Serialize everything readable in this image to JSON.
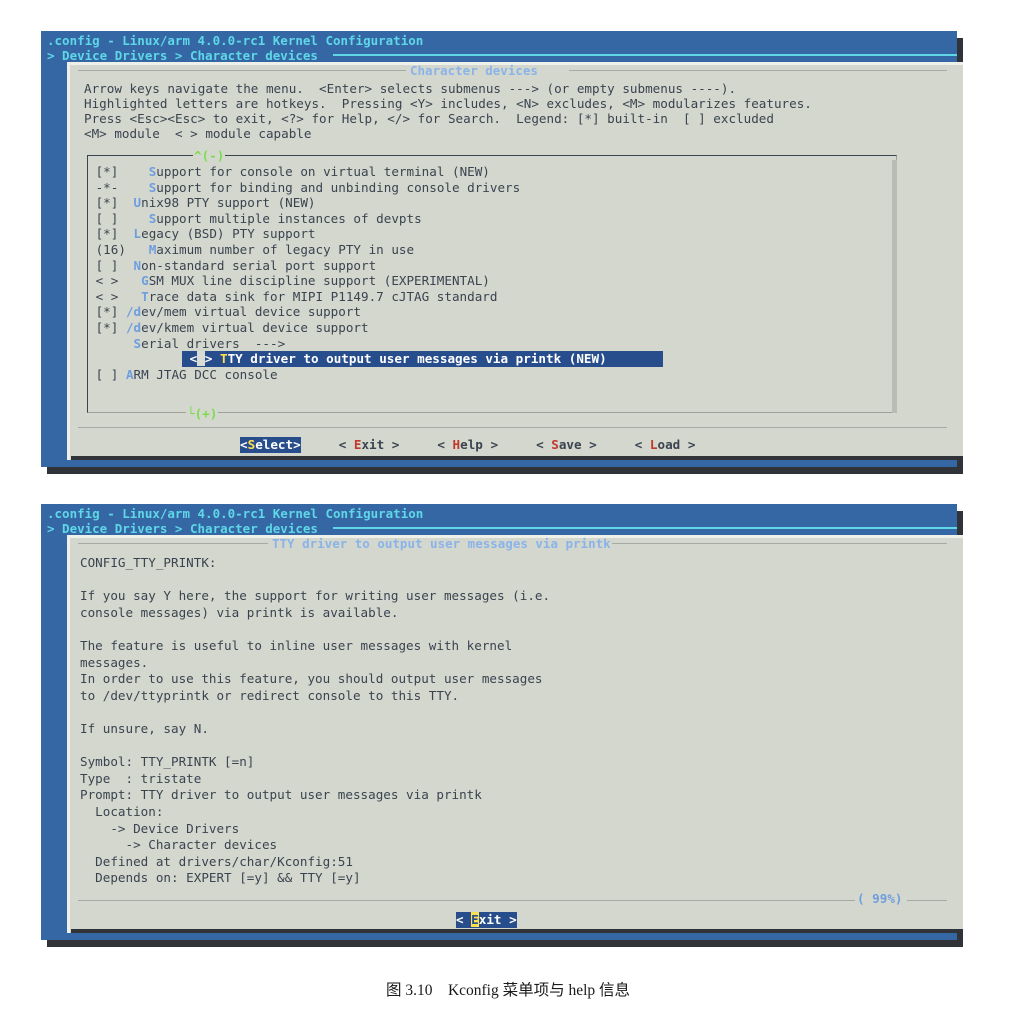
{
  "window_top": {
    "title": ".config - Linux/arm 4.0.0-rc1 Kernel Configuration",
    "path": "> Device Drivers > Character devices",
    "dialog_title": "Character devices",
    "help_lines": [
      "Arrow keys navigate the menu.  <Enter> selects submenus ---> (or empty submenus ----).",
      "Highlighted letters are hotkeys.  Pressing <Y> includes, <N> excludes, <M> modularizes features.",
      "Press <Esc><Esc> to exit, <?> for Help, </> for Search.  Legend: [*] built-in  [ ] excluded",
      "<M> module  < > module capable"
    ],
    "scroll_up_mark": "^(-)",
    "scroll_down_mark": "└(+)",
    "menu_items": [
      {
        "state": "[*]",
        "indent": "    ",
        "hotkey": "S",
        "rest": "upport for console on virtual terminal (NEW)",
        "selected": false
      },
      {
        "state": "-*-",
        "indent": "    ",
        "hotkey": "S",
        "rest": "upport for binding and unbinding console drivers",
        "selected": false
      },
      {
        "state": "[*]",
        "indent": "  ",
        "hotkey": "U",
        "rest": "nix98 PTY support (NEW)",
        "selected": false
      },
      {
        "state": "[ ]",
        "indent": "    ",
        "hotkey": "S",
        "rest": "upport multiple instances of devpts",
        "selected": false
      },
      {
        "state": "[*]",
        "indent": "  ",
        "hotkey": "L",
        "rest": "egacy (BSD) PTY support",
        "selected": false
      },
      {
        "state": "(16)",
        "indent": "   ",
        "hotkey": "M",
        "rest": "aximum number of legacy PTY in use",
        "selected": false
      },
      {
        "state": "[ ]",
        "indent": "  ",
        "hotkey": "N",
        "rest": "on-standard serial port support",
        "selected": false
      },
      {
        "state": "< >",
        "indent": "   ",
        "hotkey": "G",
        "rest": "SM MUX line discipline support (EXPERIMENTAL)",
        "selected": false
      },
      {
        "state": "< >",
        "indent": "   ",
        "hotkey": "T",
        "rest": "race data sink for MIPI P1149.7 cJTAG standard",
        "selected": false
      },
      {
        "state": "[*]",
        "indent": " ",
        "hotkey": "/d",
        "rest": "ev/mem virtual device support",
        "selected": false
      },
      {
        "state": "[*]",
        "indent": " ",
        "hotkey": "/d",
        "rest": "ev/kmem virtual device support",
        "selected": false
      },
      {
        "state": "   ",
        "indent": "  ",
        "hotkey": "S",
        "rest": "erial drivers  --->",
        "selected": false
      },
      {
        "state": "< >",
        "indent": " ",
        "hotkey": "T",
        "rest": "TY driver to output user messages via printk (NEW)",
        "selected": true
      },
      {
        "state": "[ ]",
        "indent": " ",
        "hotkey": "A",
        "rest": "RM JTAG DCC console",
        "selected": false
      }
    ],
    "buttons": [
      {
        "label": "<Select>",
        "hotkey": "S",
        "pre": "<",
        "post": "elect>",
        "active": true
      },
      {
        "label": "< Exit >",
        "hotkey": "E",
        "pre": "< ",
        "post": "xit >",
        "active": false
      },
      {
        "label": "< Help >",
        "hotkey": "H",
        "pre": "< ",
        "post": "elp >",
        "active": false
      },
      {
        "label": "< Save >",
        "hotkey": "S",
        "pre": "< ",
        "post": "ave >",
        "active": false
      },
      {
        "label": "< Load >",
        "hotkey": "L",
        "pre": "< ",
        "post": "oad >",
        "active": false
      }
    ]
  },
  "window_bottom": {
    "title": ".config - Linux/arm 4.0.0-rc1 Kernel Configuration",
    "path": "> Device Drivers > Character devices",
    "dialog_title": "TTY driver to output user messages via printk",
    "help_text_lines": [
      "CONFIG_TTY_PRINTK:",
      "",
      "If you say Y here, the support for writing user messages (i.e.",
      "console messages) via printk is available.",
      "",
      "The feature is useful to inline user messages with kernel",
      "messages.",
      "In order to use this feature, you should output user messages",
      "to /dev/ttyprintk or redirect console to this TTY.",
      "",
      "If unsure, say N.",
      "",
      "Symbol: TTY_PRINTK [=n]",
      "Type  : tristate",
      "Prompt: TTY driver to output user messages via printk",
      "  Location:",
      "    -> Device Drivers",
      "      -> Character devices",
      "  Defined at drivers/char/Kconfig:51",
      "  Depends on: EXPERT [=y] && TTY [=y]"
    ],
    "scroll_percent": "( 99%)",
    "buttons": [
      {
        "label": "< Exit >",
        "hotkey": "E",
        "pre": "< ",
        "post": "xit >",
        "active": true
      }
    ]
  },
  "caption": "图 3.10 Kconfig 菜单项与 help 信息",
  "colors": {
    "terminal_blue": "#3467a4",
    "dialog_grey": "#d4d7ce",
    "accent_cyan": "#5fd7e7",
    "hotkey_blue": "#6f9ede",
    "selected_blue": "#274d8c",
    "hotkey_yellow": "#ffe14d",
    "button_red": "#c0392b",
    "scroll_green": "#7ddc4c",
    "shadow": "#303438"
  }
}
